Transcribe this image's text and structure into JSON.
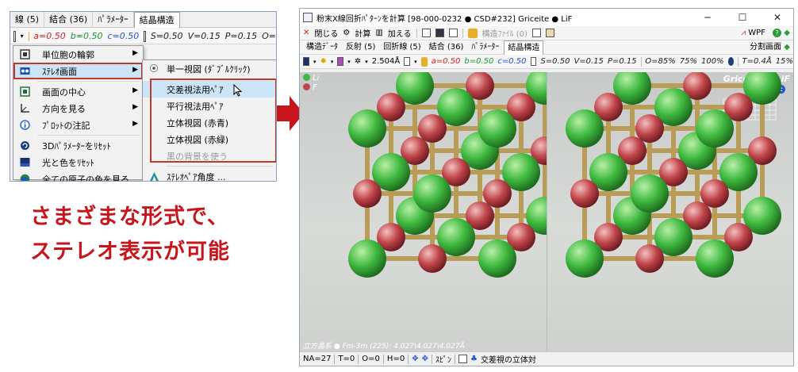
{
  "left": {
    "tabs": [
      "線 (5)",
      "結合 (36)",
      "ﾊﾟﾗﾒｰﾀｰ",
      "結晶構造"
    ],
    "params": {
      "a": "a=0.50",
      "b": "b=0.50",
      "c": "c=0.50",
      "S": "S=0.50",
      "V": "V=0.15",
      "P": "P=0.15",
      "O": "O="
    },
    "menu": [
      {
        "label": "単位胞の輪郭",
        "icon": "unit-cell-icon",
        "submenu": true
      },
      {
        "label": "ｽﾃﾚｵ画面",
        "icon": "stereo-icon",
        "submenu": true,
        "highlighted": true
      },
      {
        "label": "画面の中心",
        "icon": "center-icon",
        "submenu": true
      },
      {
        "label": "方向を見る",
        "icon": "axis-icon",
        "submenu": true
      },
      {
        "label": "ﾌﾟﾛｯﾄの注記",
        "icon": "info-icon",
        "submenu": true
      },
      {
        "label": "3Dﾊﾟﾗﾒｰﾀｰをﾘｾｯﾄ",
        "icon": "reset-icon",
        "submenu": false
      },
      {
        "label": "光と色をﾘｾｯﾄ",
        "icon": "light-icon",
        "submenu": false
      },
      {
        "label": "全ての原子の色を見る",
        "icon": "globe-icon",
        "submenu": false
      }
    ],
    "submenu": [
      {
        "label": "単一視図 (ﾀﾞﾌﾞﾙｸﾘｯｸ)",
        "disabled": false
      },
      {
        "label": "交差視法用ﾍﾟｱ",
        "disabled": false,
        "hovered": true
      },
      {
        "label": "平行視法用ﾍﾟｱ",
        "disabled": false
      },
      {
        "label": "立体視図 (赤青)",
        "disabled": false
      },
      {
        "label": "立体視図 (赤緑)",
        "disabled": false
      },
      {
        "label": "黒の背景を使う",
        "disabled": true
      },
      {
        "label": "ｽﾃﾚｵﾍﾟｱ角度 ...",
        "disabled": false
      }
    ]
  },
  "caption": {
    "line1": "さまざまな形式で、",
    "line2": "ステレオ表示が可能"
  },
  "window": {
    "title": "粉末X線回折ﾊﾟﾀｰﾝを計算 [98-000-0232 ● CSD#232] Griceite ● LiF",
    "toolbar": {
      "close": "閉じる",
      "calc": "計算",
      "add": "加える",
      "structure_file": "構造ﾌｧｲﾙ (0)",
      "wpf": "WPF"
    },
    "tabs": [
      "構造ﾃﾞｰﾀ",
      "反射 (5)",
      "回折線 (5)",
      "結合 (36)",
      "ﾊﾟﾗﾒｰﾀｰ",
      "結晶構造"
    ],
    "split_label": "分割画面",
    "params": {
      "dist": "2.504Å",
      "a": "a=0.50",
      "b": "b=0.50",
      "c": "c=0.50",
      "S": "S=0.50",
      "V": "V=0.15",
      "P": "P=0.15",
      "O": "O=85%",
      "p75": "75%",
      "p100": "100%",
      "T": "T=0.4Å",
      "p15": "15%"
    },
    "legend": [
      {
        "label": "Li",
        "color": "#3fb93f"
      },
      {
        "label": "F",
        "color": "#c0454a"
      }
    ],
    "phase_title": "Griceite ● LiF",
    "axes": [
      "a",
      "b",
      "c"
    ],
    "cell_info": "立方晶系 ● Fm-3m (225): 4.027\\4.027\\4.027Å",
    "status": {
      "na": "NA=27",
      "t": "T=0",
      "o": "O=0",
      "h": "H=0",
      "spin": "ｽﾋﾟﾝ",
      "mode": "交差視の立体対"
    }
  },
  "colors": {
    "accent_red": "#c8151b",
    "li": "#3fb93f",
    "f": "#c0454a"
  }
}
